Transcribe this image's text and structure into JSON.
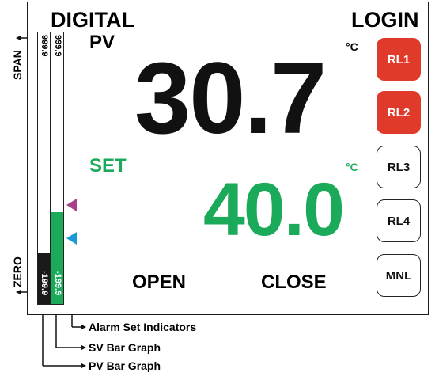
{
  "header": {
    "left_title": "DIGITAL",
    "right_title": "LOGIN"
  },
  "pv": {
    "label": "PV",
    "value": "30.7",
    "unit": "°C"
  },
  "sv": {
    "label": "SET",
    "value": "40.0",
    "unit": "°C"
  },
  "relays": [
    {
      "label": "RL1",
      "active": true
    },
    {
      "label": "RL2",
      "active": true
    },
    {
      "label": "RL3",
      "active": false
    },
    {
      "label": "RL4",
      "active": false
    },
    {
      "label": "MNL",
      "active": false
    }
  ],
  "actions": {
    "open": "OPEN",
    "close": "CLOSE"
  },
  "bars": {
    "pv_max": "999.9",
    "pv_min": "-199.9",
    "sv_max": "999.9",
    "sv_min": "-199.9",
    "pv_fill_fraction": 0.19,
    "sv_fill_fraction": 0.34
  },
  "side_labels": {
    "span": "SPAN",
    "zero": "ZERO"
  },
  "callouts": {
    "alarm": "Alarm Set Indicators",
    "sv_bar": "SV Bar Graph",
    "pv_bar": "PV Bar Graph"
  },
  "colors": {
    "relay_active": "#e03a2b",
    "sv_green": "#1aaa5a",
    "alarm_high": "#a8408a",
    "alarm_low": "#1c9ad6"
  }
}
